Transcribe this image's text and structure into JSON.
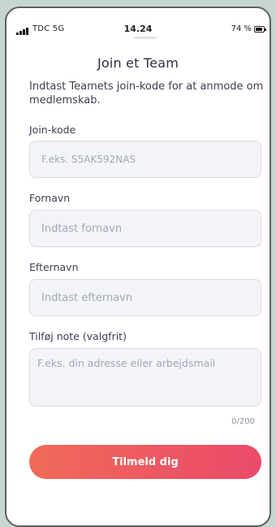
{
  "status_bar": {
    "carrier": "TDC  5G",
    "time": "14.24",
    "battery": "74 %"
  },
  "header": {
    "title": "Join et Team"
  },
  "description": "Indtast Teamets join-kode for at anmode om medlemskab.",
  "form": {
    "join_code": {
      "label": "Join-kode",
      "placeholder": "F.eks. S5AK592NAS"
    },
    "first_name": {
      "label": "Fornavn",
      "placeholder": "Indtast fornavn"
    },
    "last_name": {
      "label": "Efternavn",
      "placeholder": "Indtast efternavn"
    },
    "note": {
      "label": "Tilføj note (valgfrit)",
      "placeholder": "F.eks. din adresse eller arbejdsmail",
      "char_count": "0/200"
    }
  },
  "submit_label": "Tilmeld dig",
  "colors": {
    "accent_start": "#f06a59",
    "accent_end": "#ea4a6a",
    "background": "#c5d7d0"
  },
  "icons": {
    "signal": "signal-bars-icon",
    "battery": "battery-icon"
  }
}
